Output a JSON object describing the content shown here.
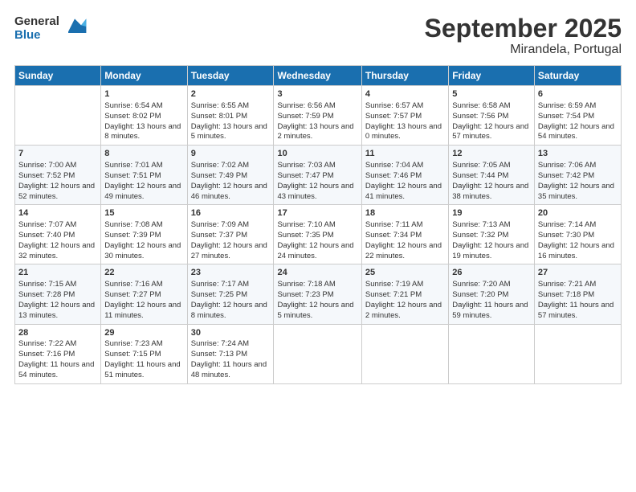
{
  "logo": {
    "line1": "General",
    "line2": "Blue"
  },
  "title": "September 2025",
  "subtitle": "Mirandela, Portugal",
  "days_of_week": [
    "Sunday",
    "Monday",
    "Tuesday",
    "Wednesday",
    "Thursday",
    "Friday",
    "Saturday"
  ],
  "weeks": [
    [
      {
        "day": "",
        "sunrise": "",
        "sunset": "",
        "daylight": ""
      },
      {
        "day": "1",
        "sunrise": "Sunrise: 6:54 AM",
        "sunset": "Sunset: 8:02 PM",
        "daylight": "Daylight: 13 hours and 8 minutes."
      },
      {
        "day": "2",
        "sunrise": "Sunrise: 6:55 AM",
        "sunset": "Sunset: 8:01 PM",
        "daylight": "Daylight: 13 hours and 5 minutes."
      },
      {
        "day": "3",
        "sunrise": "Sunrise: 6:56 AM",
        "sunset": "Sunset: 7:59 PM",
        "daylight": "Daylight: 13 hours and 2 minutes."
      },
      {
        "day": "4",
        "sunrise": "Sunrise: 6:57 AM",
        "sunset": "Sunset: 7:57 PM",
        "daylight": "Daylight: 13 hours and 0 minutes."
      },
      {
        "day": "5",
        "sunrise": "Sunrise: 6:58 AM",
        "sunset": "Sunset: 7:56 PM",
        "daylight": "Daylight: 12 hours and 57 minutes."
      },
      {
        "day": "6",
        "sunrise": "Sunrise: 6:59 AM",
        "sunset": "Sunset: 7:54 PM",
        "daylight": "Daylight: 12 hours and 54 minutes."
      }
    ],
    [
      {
        "day": "7",
        "sunrise": "Sunrise: 7:00 AM",
        "sunset": "Sunset: 7:52 PM",
        "daylight": "Daylight: 12 hours and 52 minutes."
      },
      {
        "day": "8",
        "sunrise": "Sunrise: 7:01 AM",
        "sunset": "Sunset: 7:51 PM",
        "daylight": "Daylight: 12 hours and 49 minutes."
      },
      {
        "day": "9",
        "sunrise": "Sunrise: 7:02 AM",
        "sunset": "Sunset: 7:49 PM",
        "daylight": "Daylight: 12 hours and 46 minutes."
      },
      {
        "day": "10",
        "sunrise": "Sunrise: 7:03 AM",
        "sunset": "Sunset: 7:47 PM",
        "daylight": "Daylight: 12 hours and 43 minutes."
      },
      {
        "day": "11",
        "sunrise": "Sunrise: 7:04 AM",
        "sunset": "Sunset: 7:46 PM",
        "daylight": "Daylight: 12 hours and 41 minutes."
      },
      {
        "day": "12",
        "sunrise": "Sunrise: 7:05 AM",
        "sunset": "Sunset: 7:44 PM",
        "daylight": "Daylight: 12 hours and 38 minutes."
      },
      {
        "day": "13",
        "sunrise": "Sunrise: 7:06 AM",
        "sunset": "Sunset: 7:42 PM",
        "daylight": "Daylight: 12 hours and 35 minutes."
      }
    ],
    [
      {
        "day": "14",
        "sunrise": "Sunrise: 7:07 AM",
        "sunset": "Sunset: 7:40 PM",
        "daylight": "Daylight: 12 hours and 32 minutes."
      },
      {
        "day": "15",
        "sunrise": "Sunrise: 7:08 AM",
        "sunset": "Sunset: 7:39 PM",
        "daylight": "Daylight: 12 hours and 30 minutes."
      },
      {
        "day": "16",
        "sunrise": "Sunrise: 7:09 AM",
        "sunset": "Sunset: 7:37 PM",
        "daylight": "Daylight: 12 hours and 27 minutes."
      },
      {
        "day": "17",
        "sunrise": "Sunrise: 7:10 AM",
        "sunset": "Sunset: 7:35 PM",
        "daylight": "Daylight: 12 hours and 24 minutes."
      },
      {
        "day": "18",
        "sunrise": "Sunrise: 7:11 AM",
        "sunset": "Sunset: 7:34 PM",
        "daylight": "Daylight: 12 hours and 22 minutes."
      },
      {
        "day": "19",
        "sunrise": "Sunrise: 7:13 AM",
        "sunset": "Sunset: 7:32 PM",
        "daylight": "Daylight: 12 hours and 19 minutes."
      },
      {
        "day": "20",
        "sunrise": "Sunrise: 7:14 AM",
        "sunset": "Sunset: 7:30 PM",
        "daylight": "Daylight: 12 hours and 16 minutes."
      }
    ],
    [
      {
        "day": "21",
        "sunrise": "Sunrise: 7:15 AM",
        "sunset": "Sunset: 7:28 PM",
        "daylight": "Daylight: 12 hours and 13 minutes."
      },
      {
        "day": "22",
        "sunrise": "Sunrise: 7:16 AM",
        "sunset": "Sunset: 7:27 PM",
        "daylight": "Daylight: 12 hours and 11 minutes."
      },
      {
        "day": "23",
        "sunrise": "Sunrise: 7:17 AM",
        "sunset": "Sunset: 7:25 PM",
        "daylight": "Daylight: 12 hours and 8 minutes."
      },
      {
        "day": "24",
        "sunrise": "Sunrise: 7:18 AM",
        "sunset": "Sunset: 7:23 PM",
        "daylight": "Daylight: 12 hours and 5 minutes."
      },
      {
        "day": "25",
        "sunrise": "Sunrise: 7:19 AM",
        "sunset": "Sunset: 7:21 PM",
        "daylight": "Daylight: 12 hours and 2 minutes."
      },
      {
        "day": "26",
        "sunrise": "Sunrise: 7:20 AM",
        "sunset": "Sunset: 7:20 PM",
        "daylight": "Daylight: 11 hours and 59 minutes."
      },
      {
        "day": "27",
        "sunrise": "Sunrise: 7:21 AM",
        "sunset": "Sunset: 7:18 PM",
        "daylight": "Daylight: 11 hours and 57 minutes."
      }
    ],
    [
      {
        "day": "28",
        "sunrise": "Sunrise: 7:22 AM",
        "sunset": "Sunset: 7:16 PM",
        "daylight": "Daylight: 11 hours and 54 minutes."
      },
      {
        "day": "29",
        "sunrise": "Sunrise: 7:23 AM",
        "sunset": "Sunset: 7:15 PM",
        "daylight": "Daylight: 11 hours and 51 minutes."
      },
      {
        "day": "30",
        "sunrise": "Sunrise: 7:24 AM",
        "sunset": "Sunset: 7:13 PM",
        "daylight": "Daylight: 11 hours and 48 minutes."
      },
      {
        "day": "",
        "sunrise": "",
        "sunset": "",
        "daylight": ""
      },
      {
        "day": "",
        "sunrise": "",
        "sunset": "",
        "daylight": ""
      },
      {
        "day": "",
        "sunrise": "",
        "sunset": "",
        "daylight": ""
      },
      {
        "day": "",
        "sunrise": "",
        "sunset": "",
        "daylight": ""
      }
    ]
  ]
}
